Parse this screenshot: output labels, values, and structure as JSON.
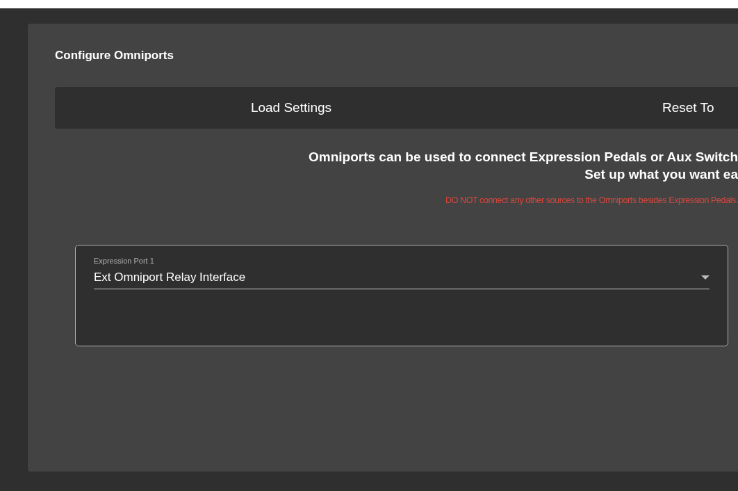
{
  "panel": {
    "title": "Configure Omniports"
  },
  "buttons": [
    "Load Settings",
    "Reset To"
  ],
  "intro_lines": [
    "Omniports can be used to connect Expression Pedals or Aux Switch",
    "Set up what you want ea"
  ],
  "warning": "DO NOT connect any other sources to the Omniports besides Expression Pedals.",
  "ports": [
    {
      "label": "Expression Port 1",
      "value": "Ext Omniport Relay Interface"
    }
  ]
}
